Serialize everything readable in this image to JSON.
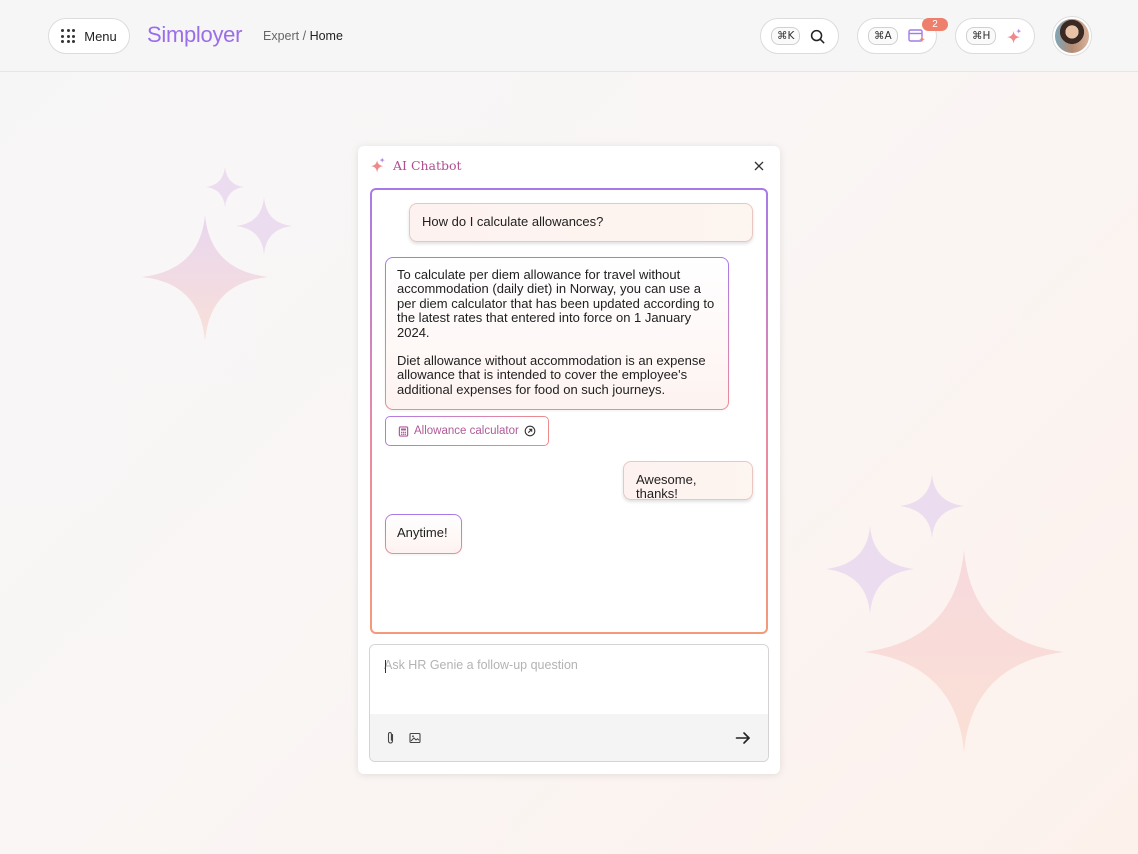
{
  "header": {
    "menu_label": "Menu",
    "brand": "Simployer",
    "breadcrumb": {
      "parent": "Expert",
      "separator": " / ",
      "current": "Home"
    },
    "search_shortcut": "⌘K",
    "assist_shortcut": "⌘A",
    "assist_badge": "2",
    "ai_shortcut": "⌘H",
    "icons": [
      "grid-icon",
      "search-icon",
      "calendar-sparkle-icon",
      "sparkle-icon"
    ]
  },
  "chat": {
    "title": "AI Chatbot",
    "messages": [
      {
        "role": "user",
        "text": "How do I calculate allowances?"
      },
      {
        "role": "bot",
        "paragraphs": [
          "To calculate per diem allowance for travel without accommodation (daily diet) in Norway, you can use a per diem calculator that has been updated according to the latest rates that entered into force on 1 January 2024.",
          "Diet allowance without accommodation is an expense allowance that is intended to cover the employee's additional expenses for food on such journeys."
        ]
      },
      {
        "role": "user",
        "text": "Awesome, thanks!"
      },
      {
        "role": "bot",
        "text": "Anytime!"
      }
    ],
    "link_chip": "Allowance calculator",
    "input_placeholder": "Ask HR Genie a follow-up question"
  },
  "colors": {
    "brand": "#9b6ee9",
    "accent_pink": "#b04f8f",
    "badge": "#ee7f6c"
  }
}
